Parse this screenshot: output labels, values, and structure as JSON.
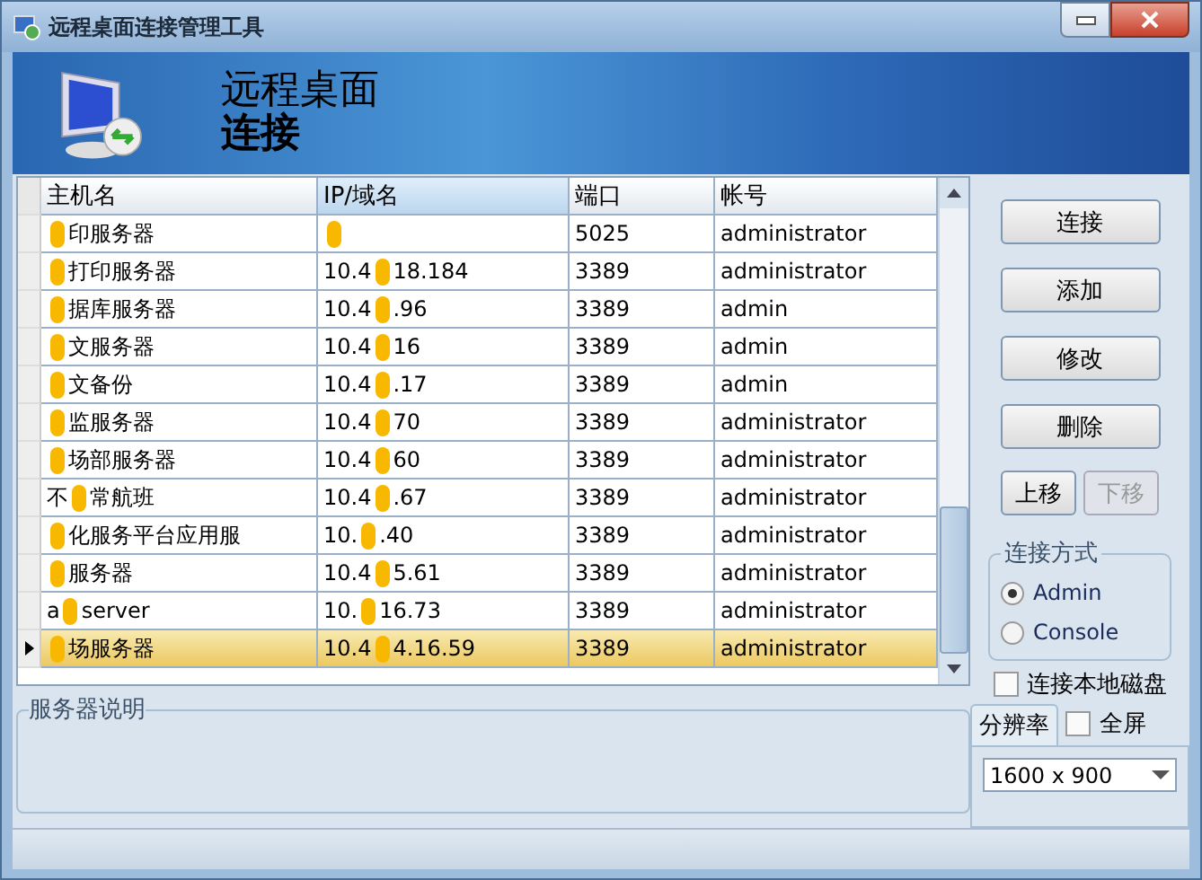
{
  "window": {
    "title": "远程桌面连接管理工具"
  },
  "banner": {
    "title_line1": "远程桌面",
    "title_line2": "连接"
  },
  "table": {
    "columns": [
      "主机名",
      "IP/域名",
      "端口",
      "帐号"
    ],
    "rows": [
      {
        "host_after": "印服务器",
        "port": "5025",
        "account": "administrator",
        "selected": false
      },
      {
        "host_after": "打印服务器",
        "ip_before": "10.4",
        "ip_after": "18.184",
        "port": "3389",
        "account": "administrator",
        "selected": false
      },
      {
        "host_after": "据库服务器",
        "ip_before": "10.4",
        "ip_after": ".96",
        "port": "3389",
        "account": "admin",
        "selected": false
      },
      {
        "host_after": "文服务器",
        "ip_before": "10.4",
        "ip_after": "16",
        "port": "3389",
        "account": "admin",
        "selected": false
      },
      {
        "host_after": "文备份",
        "ip_before": "10.4",
        "ip_after": ".17",
        "port": "3389",
        "account": "admin",
        "selected": false
      },
      {
        "host_after": "监服务器",
        "ip_before": "10.4",
        "ip_after": "70",
        "port": "3389",
        "account": "administrator",
        "selected": false
      },
      {
        "host_after": "场部服务器",
        "ip_before": "10.4",
        "ip_after": "60",
        "port": "3389",
        "account": "administrator",
        "selected": false
      },
      {
        "host_before": "不",
        "host_after": "常航班",
        "ip_before": "10.4",
        "ip_after": ".67",
        "port": "3389",
        "account": "administrator",
        "selected": false
      },
      {
        "host_after": "化服务平台应用服",
        "ip_before": "10.",
        "ip_after": ".40",
        "port": "3389",
        "account": "administrator",
        "selected": false
      },
      {
        "host_after": "服务器",
        "ip_before": "10.4",
        "ip_after": "5.61",
        "port": "3389",
        "account": "administrator",
        "selected": false
      },
      {
        "host_before": "a",
        "host_after": "server",
        "ip_before": "10.",
        "ip_after": "16.73",
        "port": "3389",
        "account": "administrator",
        "selected": false
      },
      {
        "host_after": "场服务器",
        "ip_before": "10.4",
        "ip_after": "4.16.59",
        "port": "3389",
        "account": "administrator",
        "selected": true
      }
    ]
  },
  "buttons": [
    {
      "label": "连接",
      "disabled": false
    },
    {
      "label": "添加",
      "disabled": false
    },
    {
      "label": "修改",
      "disabled": false
    },
    {
      "label": "删除",
      "disabled": false
    }
  ],
  "move_buttons": [
    {
      "label": "上移",
      "disabled": false
    },
    {
      "label": "下移",
      "disabled": true
    }
  ],
  "connect_mode": {
    "title": "连接方式",
    "options": [
      {
        "label": "Admin",
        "selected": true
      },
      {
        "label": "Console",
        "selected": false
      }
    ]
  },
  "local_disk": {
    "label": "连接本地磁盘",
    "checked": false
  },
  "resolution_tab": {
    "label": "分辨率"
  },
  "fullscreen": {
    "label": "全屏",
    "checked": false
  },
  "resolution": {
    "value": "1600 x 900"
  },
  "description_group": {
    "title": "服务器说明"
  }
}
